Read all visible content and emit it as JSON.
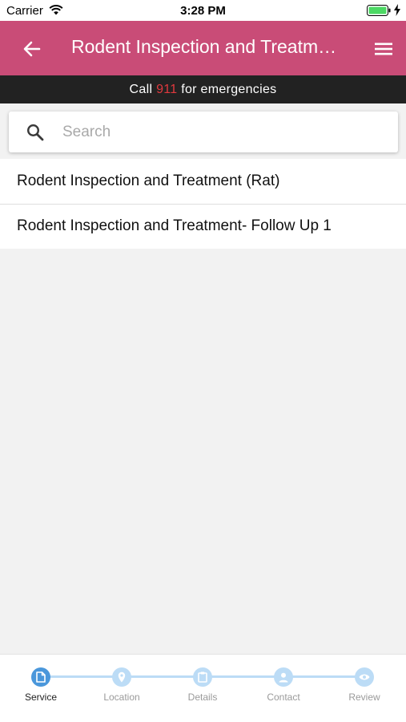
{
  "status_bar": {
    "carrier": "Carrier",
    "time": "3:28 PM"
  },
  "header": {
    "title": "Rodent Inspection and Treatment (Rat)"
  },
  "emergency": {
    "prefix": "Call ",
    "number": "911",
    "suffix": " for emergencies"
  },
  "search": {
    "placeholder": "Search",
    "value": ""
  },
  "services": [
    "Rodent Inspection and Treatment (Rat)",
    "Rodent Inspection and Treatment- Follow Up 1"
  ],
  "steps": [
    {
      "label": "Service",
      "icon": "document-icon",
      "active": true
    },
    {
      "label": "Location",
      "icon": "location-pin-icon",
      "active": false
    },
    {
      "label": "Details",
      "icon": "clipboard-icon",
      "active": false
    },
    {
      "label": "Contact",
      "icon": "person-icon",
      "active": false
    },
    {
      "label": "Review",
      "icon": "eye-icon",
      "active": false
    }
  ],
  "colors": {
    "header": "#c94c77",
    "emergency_bar": "#222222",
    "emergency_number": "#e0393e",
    "step_active": "#4a97db",
    "step_inactive": "#bcdcf6"
  }
}
